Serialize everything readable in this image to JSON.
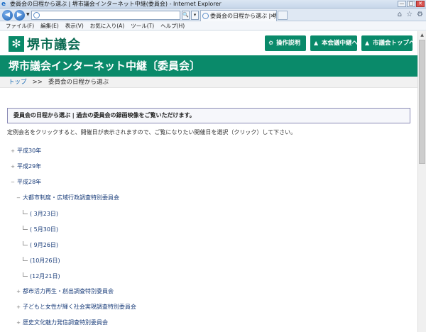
{
  "window": {
    "title": "委員会の日程から選ぶ | 堺市議会インターネット中継(委員会) - Internet Explorer",
    "controls": [
      "—",
      "□",
      "✕"
    ]
  },
  "browser": {
    "address": "",
    "tab_label": "委員会の日程から選ぶ | 堺...",
    "addr_tools": [
      "🔍",
      "▾",
      "⟳"
    ],
    "menu": [
      "ファイル(F)",
      "編集(E)",
      "表示(V)",
      "お気に入り(A)",
      "ツール(T)",
      "ヘルプ(H)"
    ],
    "icons": [
      "home-icon",
      "star-icon",
      "gear-icon"
    ]
  },
  "header": {
    "logo_text": "堺市議会",
    "buttons": [
      {
        "label": "操作説明",
        "icon": "gear-icon"
      },
      {
        "label": "本会議中継へ",
        "icon": "building-icon"
      },
      {
        "label": "市議会トップへ",
        "icon": "building-icon"
      }
    ]
  },
  "banner": {
    "title": "堺市議会インターネット中継〔委員会〕"
  },
  "breadcrumb": {
    "home": "トップ",
    "separator": ">>",
    "current": "委員会の日程から選ぶ"
  },
  "notice": {
    "text": "委員会の日程から選ぶ | 過去の委員会の録画映像をご覧いただけます。"
  },
  "intro": {
    "text": "定例会名をクリックすると、開催日が表示されますので、ご覧になりたい開催日を選択（クリック）して下さい。"
  },
  "tree": {
    "years": [
      {
        "label": "平成30年",
        "toggle": "+"
      },
      {
        "label": "平成29年",
        "toggle": "+"
      },
      {
        "label": "平成28年",
        "toggle": "−"
      }
    ],
    "committee_open": {
      "label": "大都市制度・広域行政調査特別委員会",
      "toggle": "−"
    },
    "dates": [
      "( 3月23日)",
      "( 5月30日)",
      "( 9月26日)",
      "(10月26日)",
      "(12月21日)"
    ],
    "committees_closed": [
      {
        "label": "都市活力再生・創出調査特別委員会",
        "toggle": "+"
      },
      {
        "label": "子どもと女性が輝く社会実現調査特別委員会",
        "toggle": "+"
      },
      {
        "label": "歴史文化魅力発信調査特別委員会",
        "toggle": "+"
      }
    ]
  },
  "colors": {
    "brand": "#0a8a6a",
    "link": "#1a3d7a"
  }
}
